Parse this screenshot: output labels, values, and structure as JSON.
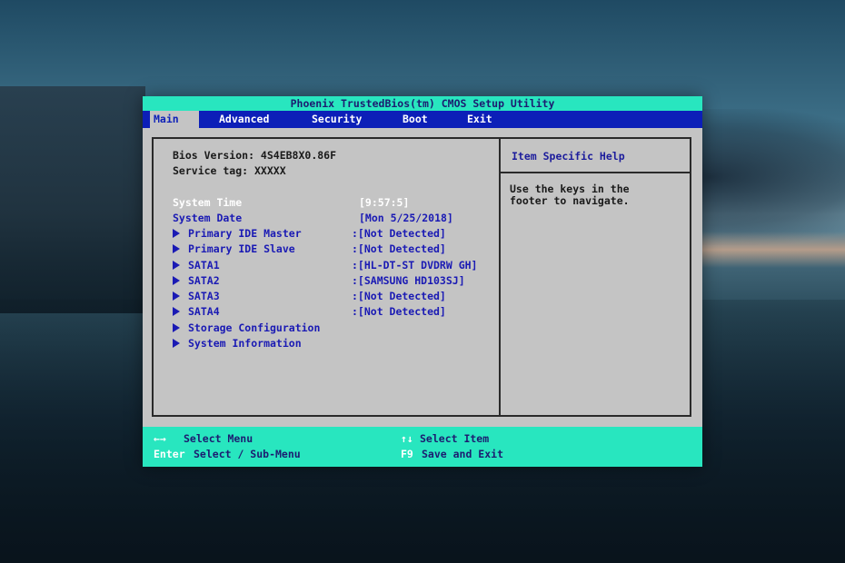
{
  "window": {
    "title": "Phoenix TrustedBios(tm) CMOS Setup Utility"
  },
  "menu": {
    "tabs": [
      {
        "label": "Main",
        "active": true
      },
      {
        "label": "Advanced"
      },
      {
        "label": "Security"
      },
      {
        "label": "Boot"
      },
      {
        "label": "Exit"
      }
    ]
  },
  "info": {
    "bios_version": "Bios Version: 4S4EB8X0.86F",
    "service_tag": "Service tag: XXXXX"
  },
  "items": [
    {
      "label": "System Time",
      "value": "[9:57:5]"
    },
    {
      "label": "System Date",
      "value": "[Mon 5/25/2018]"
    },
    {
      "label": "Primary IDE Master",
      "value": ":[Not Detected]"
    },
    {
      "label": "Primary IDE Slave",
      "value": ":[Not Detected]"
    },
    {
      "label": "SATA1",
      "value": ":[HL-DT-ST DVDRW GH]"
    },
    {
      "label": "SATA2",
      "value": ":[SAMSUNG HD103SJ]"
    },
    {
      "label": "SATA3",
      "value": ":[Not Detected]"
    },
    {
      "label": "SATA4",
      "value": ":[Not Detected]"
    },
    {
      "label": "Storage Configuration"
    },
    {
      "label": "System Information"
    }
  ],
  "help": {
    "title": "Item Specific Help",
    "text": "Use the keys in the\nfooter to navigate."
  },
  "footer": {
    "left_arrows_key": "←→",
    "left_arrows_desc": "Select Menu",
    "enter_key": "Enter",
    "enter_desc": "Select / Sub-Menu",
    "updown_key": "↑↓",
    "updown_desc": "Select Item",
    "f9_key": "F9",
    "f9_desc": "Save and Exit"
  },
  "colors": {
    "title_bar": "#28e6bf",
    "menu_bar": "#0c1fb8",
    "panel": "#c4c4c4",
    "label_blue": "#1a1ab4"
  }
}
